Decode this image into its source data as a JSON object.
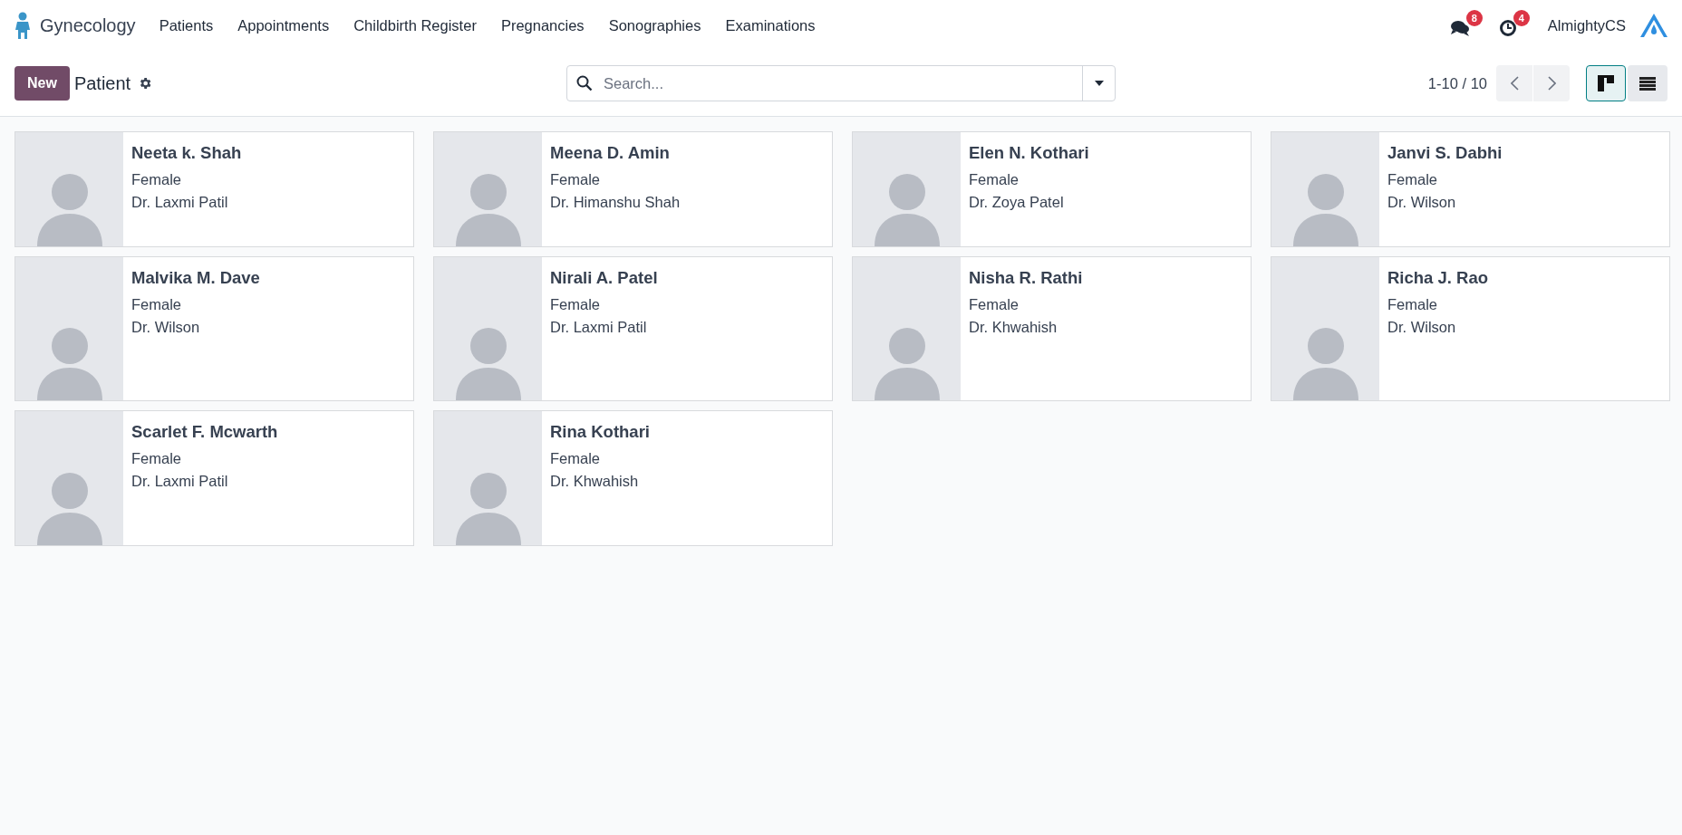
{
  "navbar": {
    "app_name": "Gynecology",
    "menu": [
      "Patients",
      "Appointments",
      "Childbirth Register",
      "Pregnancies",
      "Sonographies",
      "Examinations"
    ],
    "messages_count": "8",
    "activities_count": "4",
    "company": "AlmightyCS"
  },
  "control_panel": {
    "new_button": "New",
    "title": "Patient",
    "search": {
      "placeholder": "Search..."
    },
    "pager": "1-10 / 10",
    "views": [
      {
        "kind": "kanban",
        "selected": true
      },
      {
        "kind": "list",
        "selected": false
      }
    ]
  },
  "patients": [
    {
      "name": "Neeta k. Shah",
      "gender": "Female",
      "doctor": "Dr. Laxmi Patil"
    },
    {
      "name": "Meena D. Amin",
      "gender": "Female",
      "doctor": "Dr. Himanshu Shah"
    },
    {
      "name": "Elen N. Kothari",
      "gender": "Female",
      "doctor": "Dr. Zoya Patel"
    },
    {
      "name": "Janvi S. Dabhi",
      "gender": "Female",
      "doctor": "Dr. Wilson"
    },
    {
      "name": "Malvika M. Dave",
      "gender": "Female",
      "doctor": "Dr. Wilson"
    },
    {
      "name": "Nirali A. Patel",
      "gender": "Female",
      "doctor": "Dr. Laxmi Patil"
    },
    {
      "name": "Nisha R. Rathi",
      "gender": "Female",
      "doctor": "Dr. Khwahish"
    },
    {
      "name": "Richa J. Rao",
      "gender": "Female",
      "doctor": "Dr. Wilson"
    },
    {
      "name": "Scarlet F. Mcwarth",
      "gender": "Female",
      "doctor": "Dr. Laxmi Patil"
    },
    {
      "name": "Rina Kothari",
      "gender": "Female",
      "doctor": "Dr. Khwahish"
    }
  ]
}
